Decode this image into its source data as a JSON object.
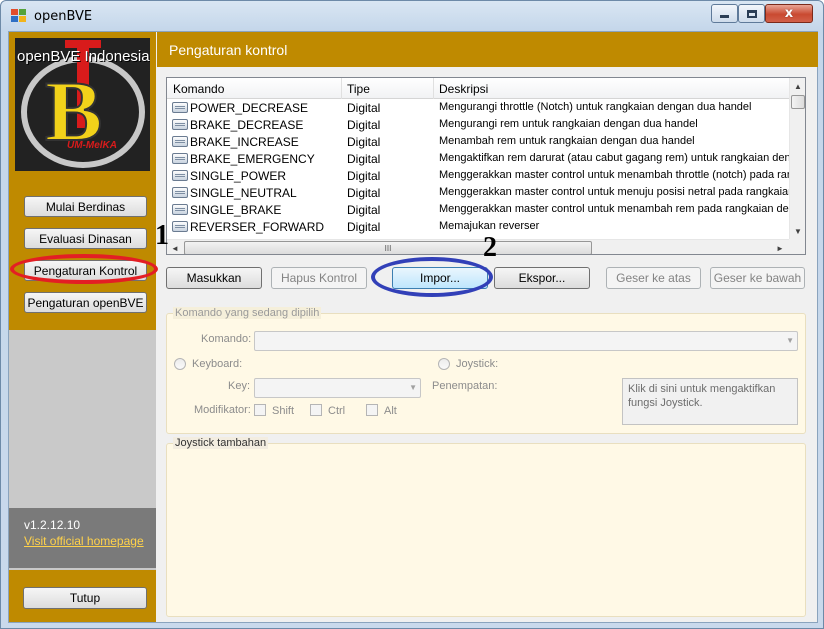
{
  "window": {
    "title": "openBVE",
    "close_glyph": "x",
    "icon": "app-window-icon"
  },
  "sidebar": {
    "logo": {
      "text": "openBVE Indonesia",
      "letter": "B",
      "subtext": "UM-MelKA"
    },
    "nav": [
      {
        "label": "Mulai Berdinas"
      },
      {
        "label": "Evaluasi Dinasan"
      },
      {
        "label": "Pengaturan Kontrol"
      },
      {
        "label": "Pengaturan openBVE"
      }
    ],
    "version": "v1.2.12.10",
    "homepage_link": "Visit official homepage",
    "close_label": "Tutup"
  },
  "main": {
    "title": "Pengaturan kontrol",
    "list": {
      "columns": [
        "Komando",
        "Tipe",
        "Deskripsi"
      ],
      "rows": [
        {
          "command": "POWER_DECREASE",
          "type": "Digital",
          "description": "Mengurangi throttle (Notch) untuk rangkaian dengan dua handel"
        },
        {
          "command": "BRAKE_DECREASE",
          "type": "Digital",
          "description": "Mengurangi rem untuk rangkaian dengan dua handel"
        },
        {
          "command": "BRAKE_INCREASE",
          "type": "Digital",
          "description": "Menambah rem untuk rangkaian dengan dua handel"
        },
        {
          "command": "BRAKE_EMERGENCY",
          "type": "Digital",
          "description": "Mengaktifkan rem darurat (atau cabut gagang rem) untuk rangkaian deng"
        },
        {
          "command": "SINGLE_POWER",
          "type": "Digital",
          "description": "Menggerakkan master control untuk menambah throttle (notch) pada rang"
        },
        {
          "command": "SINGLE_NEUTRAL",
          "type": "Digital",
          "description": "Menggerakkan master control untuk menuju posisi netral pada rangkaian d"
        },
        {
          "command": "SINGLE_BRAKE",
          "type": "Digital",
          "description": "Menggerakkan master control untuk menambah rem pada rangkaian deng"
        },
        {
          "command": "REVERSER_FORWARD",
          "type": "Digital",
          "description": "Memajukan reverser"
        }
      ],
      "scroll": {
        "up": "▲",
        "down": "▼",
        "left": "◄",
        "right": "►",
        "grip": "III"
      }
    },
    "buttons": {
      "add": "Masukkan",
      "remove": "Hapus Kontrol",
      "import": "Impor...",
      "export": "Ekspor...",
      "move_up": "Geser ke atas",
      "move_down": "Geser ke bawah"
    },
    "selected_group": {
      "legend": "Komando yang sedang dipilih",
      "command_label": "Komando:",
      "keyboard_label": "Keyboard:",
      "joystick_label": "Joystick:",
      "key_label": "Key:",
      "placement_label": "Penempatan:",
      "modifier_label": "Modifikator:",
      "modifiers": [
        "Shift",
        "Ctrl",
        "Alt"
      ],
      "joystick_hint": "Klik di sini untuk mengaktifkan fungsi Joystick.",
      "combo_arrow": "▼"
    },
    "joystick_group": {
      "legend": "Joystick tambahan"
    }
  },
  "annotations": {
    "step1": "1",
    "step2": "2",
    "colors": {
      "red": "#e31e24",
      "blue": "#3240b8"
    }
  },
  "colors": {
    "accent": "#bf8a00",
    "sidebar_gray": "#c9c9c9",
    "version_bg": "#7a7a7a",
    "link": "#ffd24a"
  }
}
